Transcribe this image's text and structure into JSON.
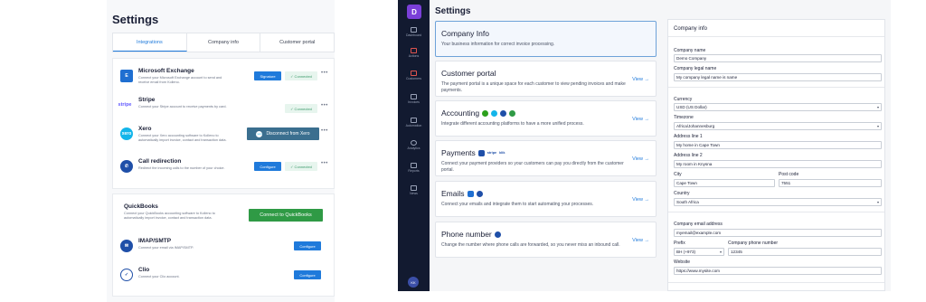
{
  "left": {
    "title": "Settings",
    "tabs": [
      "Integrations",
      "Company info",
      "Customer portal"
    ],
    "integrations": [
      {
        "name": "Microsoft Exchange",
        "desc": "Connect your Microsoft Exchange account to send and receive email from Kolleno.",
        "icon": "exchange-icon",
        "color": "#1f6fd1",
        "button": "Signature",
        "status": "✓ Connected",
        "more": "•••"
      },
      {
        "name": "Stripe",
        "desc": "Connect your Stripe account to receive payments by card.",
        "icon": "stripe-icon",
        "status": "✓ Connected",
        "more": "•••"
      },
      {
        "name": "Xero",
        "desc": "Connect your Xero accounting software to Kolleno to automatically import invoice, contact and transaction data.",
        "icon": "xero-icon",
        "color": "#13b5ea",
        "button": "Disconnect from Xero",
        "badge": "xero",
        "more": "•••"
      },
      {
        "name": "Call redirection",
        "desc": "Redirect the incoming calls to the number of your choice.",
        "icon": "phone-icon",
        "color": "#1f4fa8",
        "button": "Configure",
        "status": "✓ Connected",
        "more": "•••"
      }
    ],
    "others": [
      {
        "name": "QuickBooks",
        "desc": "Connect your QuickBooks accounting software to Kolleno to automatically import invoice, contact and transaction data.",
        "button": "Connect to QuickBooks"
      },
      {
        "name": "IMAP/SMTP",
        "desc": "Connect your email via IMAP/SMTP.",
        "icon": "envelope-icon",
        "button": "Configure"
      },
      {
        "name": "Clio",
        "desc": "Connect your Clio account.",
        "icon": "clio-icon",
        "button": "Configure"
      }
    ],
    "stripe_logo": "stripe",
    "xero_logo": "xero"
  },
  "right": {
    "logo": "D",
    "title": "Settings",
    "sidebar": [
      "Dashboard",
      "Actions",
      "Customers",
      "Invoices",
      "Automation",
      "Analytics",
      "Reports",
      "News"
    ],
    "avatar": "KK",
    "cards": [
      {
        "title": "Company Info",
        "desc": "Your business information for correct invoice processing.",
        "view": ""
      },
      {
        "title": "Customer portal",
        "desc": "The payment portal is a unique space for each customer to view pending invoices and make payments.",
        "view": "View →"
      },
      {
        "title": "Accounting",
        "desc": "Integrate different accounting platforms to have a more unified process.",
        "view": "View →"
      },
      {
        "title": "Payments",
        "desc": "Connect your payment providers so your customers can pay you directly from the customer portal.",
        "view": "View →",
        "badges": [
          "stripe",
          "klik"
        ]
      },
      {
        "title": "Emails",
        "desc": "Connect your emails and integrate them to start automating your processes.",
        "view": "View →"
      },
      {
        "title": "Phone number",
        "desc": "Change the number where phone calls are forwarded, so you never miss an inbound call.",
        "view": "View →"
      }
    ],
    "form": {
      "heading": "Company info",
      "company_name_label": "Company name",
      "company_name": "Demo Company",
      "legal_name_label": "Company legal name",
      "legal_name": "My company legal name is name",
      "currency_label": "Currency",
      "currency": "USD (US Dollar)",
      "timezone_label": "Timezone",
      "timezone": "Africa/Johannesburg",
      "address1_label": "Address line 1",
      "address1": "My home in Cape Town",
      "address2_label": "Address line 2",
      "address2": "My room in Knysna",
      "city_label": "City",
      "city": "Cape Town",
      "postcode_label": "Post code",
      "postcode": "7551",
      "country_label": "Country",
      "country": "South Africa",
      "email_label": "Company email address",
      "email": "myemail@example.com",
      "prefix_label": "Prefix",
      "prefix": "BH (+973)",
      "phone_label": "Company phone number",
      "phone": "12345",
      "website_label": "Website",
      "website": "https://www.mysite.com"
    }
  }
}
